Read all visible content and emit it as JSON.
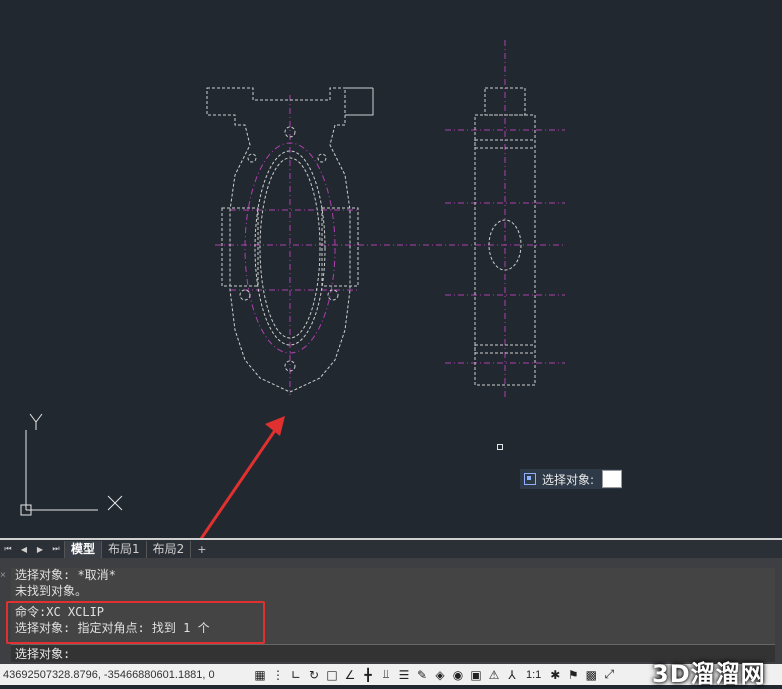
{
  "tooltip": {
    "label": "选择对象:",
    "icon": "select-objects-icon"
  },
  "tabs": {
    "nav": [
      "⏮",
      "◀",
      "▶",
      "⏭"
    ],
    "items": [
      {
        "label": "模型",
        "active": true
      },
      {
        "label": "布局1",
        "active": false
      },
      {
        "label": "布局2",
        "active": false
      },
      {
        "label": "+",
        "active": false
      }
    ]
  },
  "command": {
    "history": [
      "选择对象: *取消*",
      "未找到对象。",
      "命令:XC XCLIP",
      "选择对象: 指定对角点: 找到 1 个"
    ],
    "close_glyph": "×",
    "prompt": "选择对象:"
  },
  "status": {
    "coordinates": "43692507328.8796, -35466880601.1881, 0",
    "scale": "1:1",
    "icons": [
      "grid-icon",
      "snap-icon",
      "ortho-icon",
      "polar-icon",
      "osnap-icon",
      "otrack-icon",
      "ducs-icon",
      "dyn-icon",
      "lineweight-icon",
      "transparency-icon",
      "selection-cycling-icon",
      "3d-osnap-icon",
      "annotation-monitor-icon",
      "units-icon",
      "quick-properties-icon",
      "annotation-scale-icon",
      "workspace-icon",
      "isolate-icon",
      "hardware-icon",
      "fullscreen-icon"
    ]
  },
  "watermark": "3D溜溜网",
  "colors": {
    "background": "#212830",
    "drawing": "#cfcfcf",
    "centerline": "#b040b0",
    "highlight": "#e03030"
  }
}
